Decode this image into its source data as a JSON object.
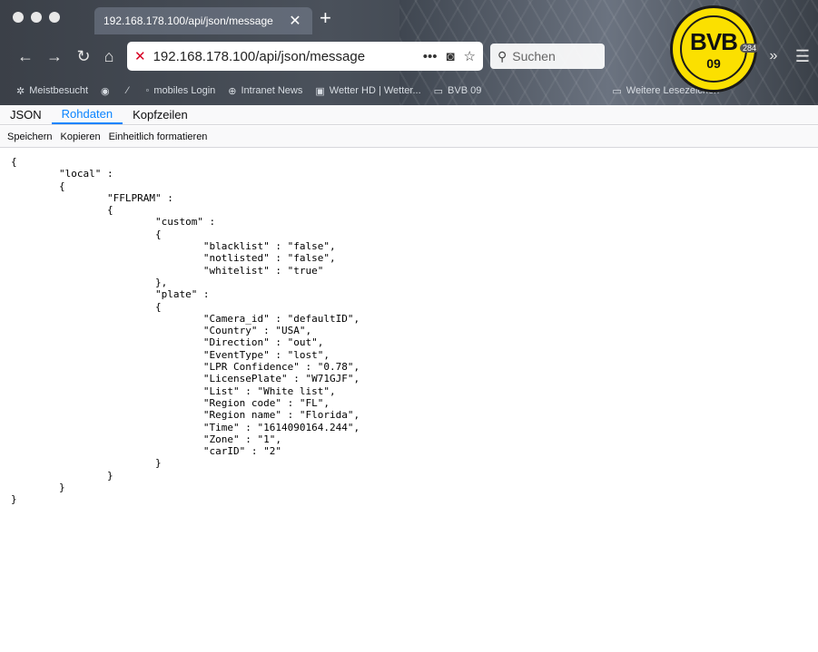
{
  "browser": {
    "tab": {
      "title": "192.168.178.100/api/json/message",
      "close": "✕"
    },
    "new_tab": "+",
    "url": "192.168.178.100/api/json/message",
    "search_placeholder": "Suchen",
    "bookmarks": [
      "Meistbesucht",
      "mobiles Login",
      "Intranet News",
      "Wetter HD | Wetter...",
      "BVB 09",
      "Weitere Lesezeichen"
    ],
    "logo_letters": "BVB",
    "logo_year": "09",
    "badge": "284"
  },
  "viewer": {
    "tabs": [
      "JSON",
      "Rohdaten",
      "Kopfzeilen"
    ],
    "active_tab": "Rohdaten",
    "toolbar": [
      "Speichern",
      "Kopieren",
      "Einheitlich formatieren"
    ]
  },
  "raw_lines": [
    "{",
    "\t\"local\" :",
    "\t{",
    "\t\t\"FFLPRAM\" :",
    "\t\t{",
    "\t\t\t\"custom\" :",
    "\t\t\t{",
    "\t\t\t\t\"blacklist\" : \"false\",",
    "\t\t\t\t\"notlisted\" : \"false\",",
    "\t\t\t\t\"whitelist\" : \"true\"",
    "\t\t\t},",
    "\t\t\t\"plate\" :",
    "\t\t\t{",
    "\t\t\t\t\"Camera_id\" : \"defaultID\",",
    "\t\t\t\t\"Country\" : \"USA\",",
    "\t\t\t\t\"Direction\" : \"out\",",
    "\t\t\t\t\"EventType\" : \"lost\",",
    "\t\t\t\t\"LPR Confidence\" : \"0.78\",",
    "\t\t\t\t\"LicensePlate\" : \"W71GJF\",",
    "\t\t\t\t\"List\" : \"White list\",",
    "\t\t\t\t\"Region code\" : \"FL\",",
    "\t\t\t\t\"Region name\" : \"Florida\",",
    "\t\t\t\t\"Time\" : \"1614090164.244\",",
    "\t\t\t\t\"Zone\" : \"1\",",
    "\t\t\t\t\"carID\" : \"2\"",
    "\t\t\t}",
    "\t\t}",
    "\t}",
    "}"
  ]
}
